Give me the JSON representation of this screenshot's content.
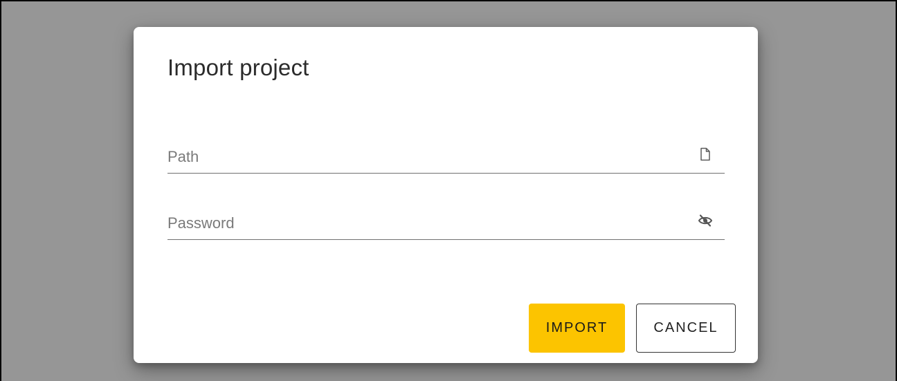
{
  "dialog": {
    "title": "Import project",
    "fields": {
      "path": {
        "placeholder": "Path",
        "value": "",
        "icon": "file-icon"
      },
      "password": {
        "placeholder": "Password",
        "value": "",
        "icon": "eye-off-icon"
      }
    },
    "buttons": {
      "import_label": "IMPORT",
      "cancel_label": "CANCEL"
    }
  },
  "colors": {
    "backdrop": "#969696",
    "accent": "#fcc400"
  }
}
